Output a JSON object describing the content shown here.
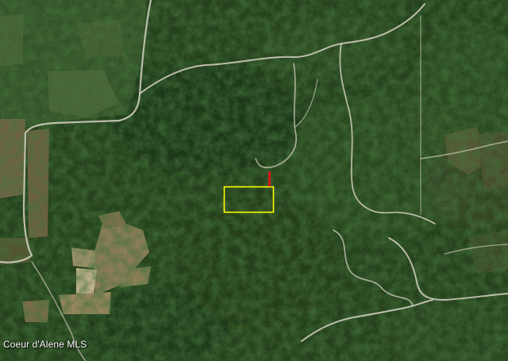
{
  "map": {
    "view": "satellite",
    "watermark_text": "Coeur d'Alene MLS",
    "parcel_outline_color": "#ffff00",
    "access_marker_color": "#d01818",
    "road_color": "#d7d2c3",
    "forest_color": "#1e3a17",
    "field_color": "#7c6a45"
  }
}
